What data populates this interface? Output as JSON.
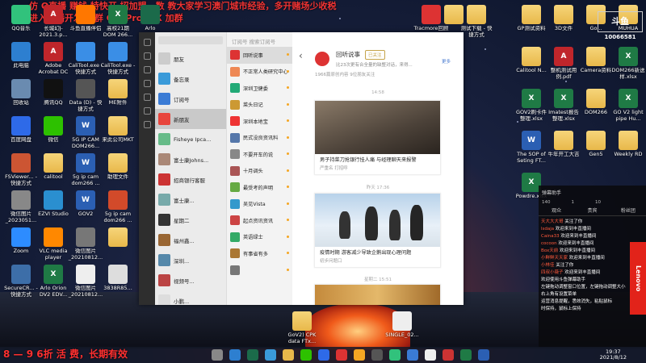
{
  "banner": {
    "line1": "仿 Q直播 赚钱 特快开 招加盟，数 教大家学习澳门城市经验，多开赌场少收税",
    "line2": "进入直播开发 加群 GeyPro  WX 加群"
  },
  "bottom_banner": "8 — 9 6折 活 费，长期有效",
  "desktop_left": [
    {
      "label": "QQ音乐",
      "kind": "app",
      "color": "#31c27c"
    },
    {
      "label": "长城幻J-2021.3.p...",
      "kind": "pdf",
      "color": ""
    },
    {
      "label": "斗鱼直播伴侣",
      "kind": "app",
      "color": "#ff7700"
    },
    {
      "label": "高校21期 DOM 266...",
      "kind": "excel",
      "color": ""
    },
    {
      "label": "Arlo",
      "kind": "app",
      "color": "#1b6a4a"
    },
    {
      "label": "此电脑",
      "kind": "app",
      "color": "#2d7fd0"
    },
    {
      "label": "Adobe Acrobat DC",
      "kind": "pdf",
      "color": ""
    },
    {
      "label": "CaliTool.exe - 快捷方式",
      "kind": "app",
      "color": "#3a8ee6"
    },
    {
      "label": "CaliTool.exe - 快捷方式",
      "kind": "app",
      "color": "#3a8ee6"
    },
    {
      "label": "",
      "kind": "folder",
      "color": ""
    },
    {
      "label": "回收站",
      "kind": "app",
      "color": "#6a8bb0"
    },
    {
      "label": "腾讯QQ",
      "kind": "app",
      "color": "#111"
    },
    {
      "label": "Data (D) - 快捷方式",
      "kind": "app",
      "color": "#555"
    },
    {
      "label": "ME附件",
      "kind": "folder",
      "color": ""
    },
    {
      "label": "",
      "kind": "folder",
      "color": ""
    },
    {
      "label": "百度网盘",
      "kind": "app",
      "color": "#2e6ae8"
    },
    {
      "label": "微信",
      "kind": "app",
      "color": "#2dc100"
    },
    {
      "label": "5G IP CAM DOM266...",
      "kind": "word",
      "color": ""
    },
    {
      "label": "来此公司MKT",
      "kind": "folder",
      "color": ""
    },
    {
      "label": "",
      "kind": "folder",
      "color": ""
    },
    {
      "label": "FSViewer... - 快捷方式",
      "kind": "app",
      "color": "#c53"
    },
    {
      "label": "calitool",
      "kind": "folder",
      "color": ""
    },
    {
      "label": "5g ip cam dom266 ...",
      "kind": "word",
      "color": ""
    },
    {
      "label": "助理文件",
      "kind": "folder",
      "color": ""
    },
    {
      "label": "",
      "kind": "folder",
      "color": ""
    },
    {
      "label": "微信图片_2023051...",
      "kind": "app",
      "color": "#888"
    },
    {
      "label": "EZVI Studio",
      "kind": "app",
      "color": "#2a8fd0"
    },
    {
      "label": "GOV2",
      "kind": "word",
      "color": ""
    },
    {
      "label": "5g ip cam dom266 ...",
      "kind": "app",
      "color": "#d24a2a"
    },
    {
      "label": "",
      "kind": "folder",
      "color": ""
    },
    {
      "label": "Zoom",
      "kind": "app",
      "color": "#2d8cff"
    },
    {
      "label": "VLC media player",
      "kind": "app",
      "color": "#ff8800"
    },
    {
      "label": "微信图片_20210812...",
      "kind": "app",
      "color": "#777"
    },
    {
      "label": "",
      "kind": "folder",
      "color": ""
    },
    {
      "label": "",
      "kind": "folder",
      "color": ""
    },
    {
      "label": "SecureCR... - 快捷方式",
      "kind": "app",
      "color": "#3d6ea8"
    },
    {
      "label": "Arlo Orion DV2 EDV...",
      "kind": "excel",
      "color": ""
    },
    {
      "label": "微信图片_20210812...",
      "kind": "app",
      "color": "#eee"
    },
    {
      "label": "3838R85...",
      "kind": "app",
      "color": "#ddd"
    },
    {
      "label": "",
      "kind": "folder",
      "color": ""
    }
  ],
  "desktop_mid": [
    {
      "label": "Tracmore回顾",
      "kind": "app",
      "color": "#d33"
    },
    {
      "label": "",
      "kind": "folder",
      "color": ""
    },
    {
      "label": "测试下载 - 快捷方式",
      "kind": "folder",
      "color": ""
    }
  ],
  "desktop_right": [
    {
      "label": "GP测试资料",
      "kind": "folder",
      "color": ""
    },
    {
      "label": "3D文件",
      "kind": "folder",
      "color": ""
    },
    {
      "label": "Go...",
      "kind": "folder",
      "color": ""
    },
    {
      "label": "MUHUA",
      "kind": "folder",
      "color": ""
    },
    {
      "label": "Calitool N...",
      "kind": "folder",
      "color": ""
    },
    {
      "label": "整机测试用例.pdf",
      "kind": "pdf",
      "color": ""
    },
    {
      "label": "Camera资料",
      "kind": "folder",
      "color": ""
    },
    {
      "label": "DOM266新送样.xlsx",
      "kind": "excel",
      "color": ""
    },
    {
      "label": "GOV2刷卡件整理.xlsx",
      "kind": "excel",
      "color": ""
    },
    {
      "label": "Imatest报告整理.xlsx",
      "kind": "excel",
      "color": ""
    },
    {
      "label": "DOM266",
      "kind": "folder",
      "color": ""
    },
    {
      "label": "GO V2 light pipe Hu...",
      "kind": "excel",
      "color": ""
    },
    {
      "label": "The SOP of Seting FT...",
      "kind": "word",
      "color": ""
    },
    {
      "label": "牛年开工大吉",
      "kind": "folder",
      "color": ""
    },
    {
      "label": "Gen5",
      "kind": "folder",
      "color": ""
    },
    {
      "label": "Weekly RD",
      "kind": "folder",
      "color": ""
    },
    {
      "label": "Powdre.xlsx",
      "kind": "excel",
      "color": ""
    }
  ],
  "desktop_bottom": [
    {
      "label": "GoV2) CPK data FTx...",
      "kind": "folder",
      "color": ""
    },
    {
      "label": "SINGLE_02...",
      "kind": "app",
      "color": "#eee"
    }
  ],
  "logo": {
    "line1": "斗鱼",
    "line2": "10066581"
  },
  "app": {
    "left_nav_icons": [
      "chat-icon",
      "contacts-icon",
      "favorites-icon",
      "files-icon",
      "moments-icon",
      "mini-program-icon",
      "settings-icon"
    ],
    "conversations": [
      {
        "name": "朋友",
        "color": "#ccc"
      },
      {
        "name": "备忘录",
        "color": "#3a9ad9"
      },
      {
        "name": "订阅号",
        "color": "#3a7bd5"
      },
      {
        "name": "新朋友",
        "color": "#e8453c"
      },
      {
        "name": "Fisheye Ipca...",
        "color": "#6b8"
      },
      {
        "name": "富士康Johns...",
        "color": "#a87"
      },
      {
        "name": "招商银行客服",
        "color": "#c33"
      },
      {
        "name": "富士康...",
        "color": "#7aa"
      },
      {
        "name": "星期二",
        "color": "#333"
      },
      {
        "name": "福州鑫...",
        "color": "#963"
      },
      {
        "name": "深圳...",
        "color": "#58a"
      },
      {
        "name": "视频号...",
        "color": "#b44"
      },
      {
        "name": "小鹏...",
        "color": "#ddd"
      },
      {
        "name": "翻译...",
        "color": "#48b"
      },
      {
        "name": "【文...",
        "color": "#555"
      }
    ],
    "sub_header": "订阅号  搜索订阅号",
    "subscriptions": [
      {
        "name": "回听说事",
        "color": "#d33"
      },
      {
        "name": "不正常人类研究中心",
        "color": "#e85"
      },
      {
        "name": "深圳卫健委",
        "color": "#2a7"
      },
      {
        "name": "菜头日记",
        "color": "#c93"
      },
      {
        "name": "深圳本地宝",
        "color": "#e33"
      },
      {
        "name": "民式没良资讯料",
        "color": "#57a"
      },
      {
        "name": "不要开车的说",
        "color": "#888"
      },
      {
        "name": "十月调头",
        "color": "#a55"
      },
      {
        "name": "最受考的声明",
        "color": "#6a4"
      },
      {
        "name": "吴见Vista",
        "color": "#39c"
      },
      {
        "name": "起点资讯资讯",
        "color": "#c44"
      },
      {
        "name": "英语绿士",
        "color": "#3a6"
      },
      {
        "name": "有事省有多",
        "color": "#a73"
      },
      {
        "name": "",
        "color": "#777"
      }
    ],
    "account": {
      "name": "回听说事",
      "badge": "已关注",
      "desc": "比23次更有合全量的缺整对话，来得...",
      "more": "更多",
      "followers": "1966篇原创内容  9位朋友关注"
    },
    "timestamps": [
      "14:58",
      "昨天 17:36",
      "星期二 15:51"
    ],
    "articles": [
      {
        "title": "男子持菜刀抢银行挂人痛 与经理聊天来报警",
        "source": "严重名  打招呼",
        "img": "#6b5e52"
      },
      {
        "title": "疫情时期 游客减少导致企鹅出现心理问题",
        "source": "初步问题口",
        "img": "#cfe0f0"
      }
    ]
  },
  "side_panel": {
    "title": "弹幕助手",
    "tabs": [
      "观众",
      "贵宾",
      "粉丝团"
    ],
    "messages": [
      {
        "user": "天大大大哥",
        "msg": "关注了你"
      },
      {
        "user": "lsdaja",
        "msg": "欢迎来到丰直播间"
      },
      {
        "user": "Caina33",
        "msg": "欢迎来到丰直播间"
      },
      {
        "user": "cocoon",
        "msg": "欢迎来到丰直播间"
      },
      {
        "user": "Box天前",
        "msg": "欢迎来到丰直播间"
      },
      {
        "user": "小鲜鲜天天家",
        "msg": "欢迎来到丰直播间"
      },
      {
        "user": "小林佳",
        "msg": "关注了你"
      },
      {
        "user": "四叔小薇子",
        "msg": "欢迎来到丰直播间"
      },
      {
        "user": "",
        "msg": "欢迎使用斗鱼弹幕助手"
      },
      {
        "user": "",
        "msg": "左键拖动调整窗口位置，左键拖动调整大小"
      },
      {
        "user": "",
        "msg": "右上角有设置菜单"
      },
      {
        "user": "",
        "msg": "运营消息提醒，悉效消失，粘贴鼠标"
      },
      {
        "user": "",
        "msg": "时保持，鼠标上保持"
      }
    ],
    "stats": [
      "140",
      "1",
      "10"
    ]
  },
  "lenovo": "Lenovo",
  "clock": {
    "time": "19:37",
    "date": "2021/8/12"
  }
}
